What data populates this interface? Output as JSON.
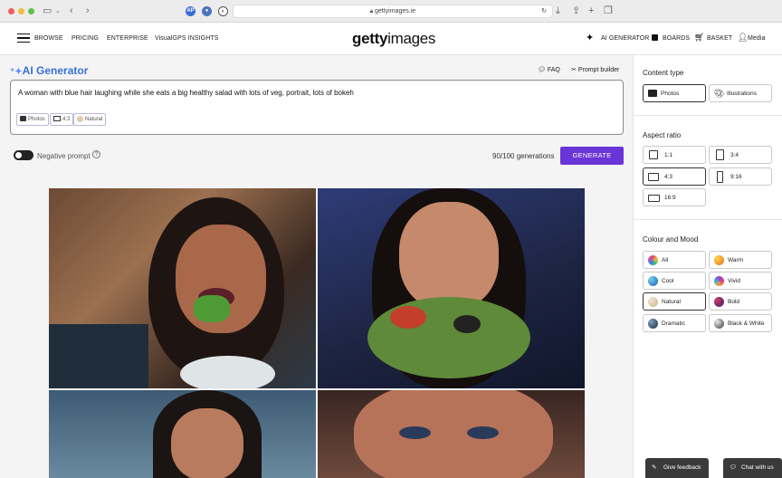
{
  "browser": {
    "url": "gettyimages.ie"
  },
  "nav": {
    "browse": "BROWSE",
    "pricing": "PRICING",
    "enterprise": "ENTERPRISE",
    "visualgps": "VisualGPS INSIGHTS",
    "logo_bold": "getty",
    "logo_light": "images",
    "ai_generator": "AI GENERATOR",
    "boards": "BOARDS",
    "basket": "BASKET",
    "media": "Media"
  },
  "generator": {
    "title": "AI Generator",
    "faq": "FAQ",
    "prompt_builder": "Prompt builder",
    "prompt": "A woman with blue hair laughing while she eats a big healthy salad with lots of veg, portrait, lots of bokeh",
    "chips": [
      {
        "label": "Photos",
        "icon": "camera-icon"
      },
      {
        "label": "4:3",
        "icon": "rectangle-icon"
      },
      {
        "label": "Natural",
        "icon": "swatch-icon"
      }
    ],
    "negative_prompt": "Negative prompt",
    "generations": "90/100 generations",
    "generate_button": "GENERATE"
  },
  "sidebar": {
    "content_type": {
      "title": "Content type",
      "options": [
        "Photos",
        "Illustrations"
      ],
      "selected": "Photos"
    },
    "aspect_ratio": {
      "title": "Aspect ratio",
      "options": [
        "1:1",
        "3:4",
        "4:3",
        "9:16",
        "16:9"
      ],
      "selected": "4:3"
    },
    "colour_mood": {
      "title": "Colour and Mood",
      "options": [
        {
          "label": "All",
          "color": "#e27ad0"
        },
        {
          "label": "Warm",
          "color": "#f0a030"
        },
        {
          "label": "Cool",
          "color": "#2b8fd6"
        },
        {
          "label": "Vivid",
          "color": "#9b3fd6"
        },
        {
          "label": "Natural",
          "color": "#e3cdb0"
        },
        {
          "label": "Bold",
          "color": "#5a2d9a"
        },
        {
          "label": "Dramatic",
          "color": "#3d5670"
        },
        {
          "label": "Black & White",
          "color": "#9a9a9a"
        }
      ],
      "selected": "Natural"
    }
  },
  "footer": {
    "feedback": "Give feedback",
    "chat": "Chat with us"
  }
}
